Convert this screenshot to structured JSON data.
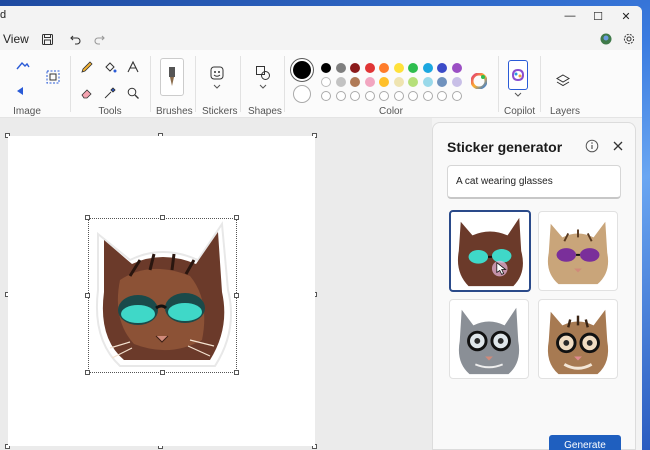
{
  "window": {
    "title_fragment": "d",
    "controls": {
      "minimize": "—",
      "maximize": "☐",
      "close": "✕"
    }
  },
  "menu": {
    "view_label": "View"
  },
  "ribbon": {
    "groups": {
      "image": "Image",
      "tools": "Tools",
      "brushes": "Brushes",
      "stickers": "Stickers",
      "shapes": "Shapes",
      "color": "Color",
      "copilot": "Copilot",
      "layers": "Layers"
    },
    "colors": {
      "primary": "#000000",
      "secondary": "#ffffff",
      "row1": [
        "#000000",
        "#7f7f7f",
        "#8b1a1a",
        "#e03535",
        "#ff7c2a",
        "#ffe13a",
        "#2ebd4e",
        "#1ba7e0",
        "#3b4bc8",
        "#9b4fc4"
      ],
      "row2": [
        "#ffffff",
        "#c3c3c3",
        "#b07a57",
        "#f2a6c0",
        "#ffc02a",
        "#efe4b0",
        "#b6e07a",
        "#99d9ea",
        "#7092be",
        "#c8bfe7"
      ],
      "row3_empty": 10
    }
  },
  "panel": {
    "title": "Sticker generator",
    "prompt_value": "A cat wearing glasses",
    "generate_label": "Generate"
  }
}
